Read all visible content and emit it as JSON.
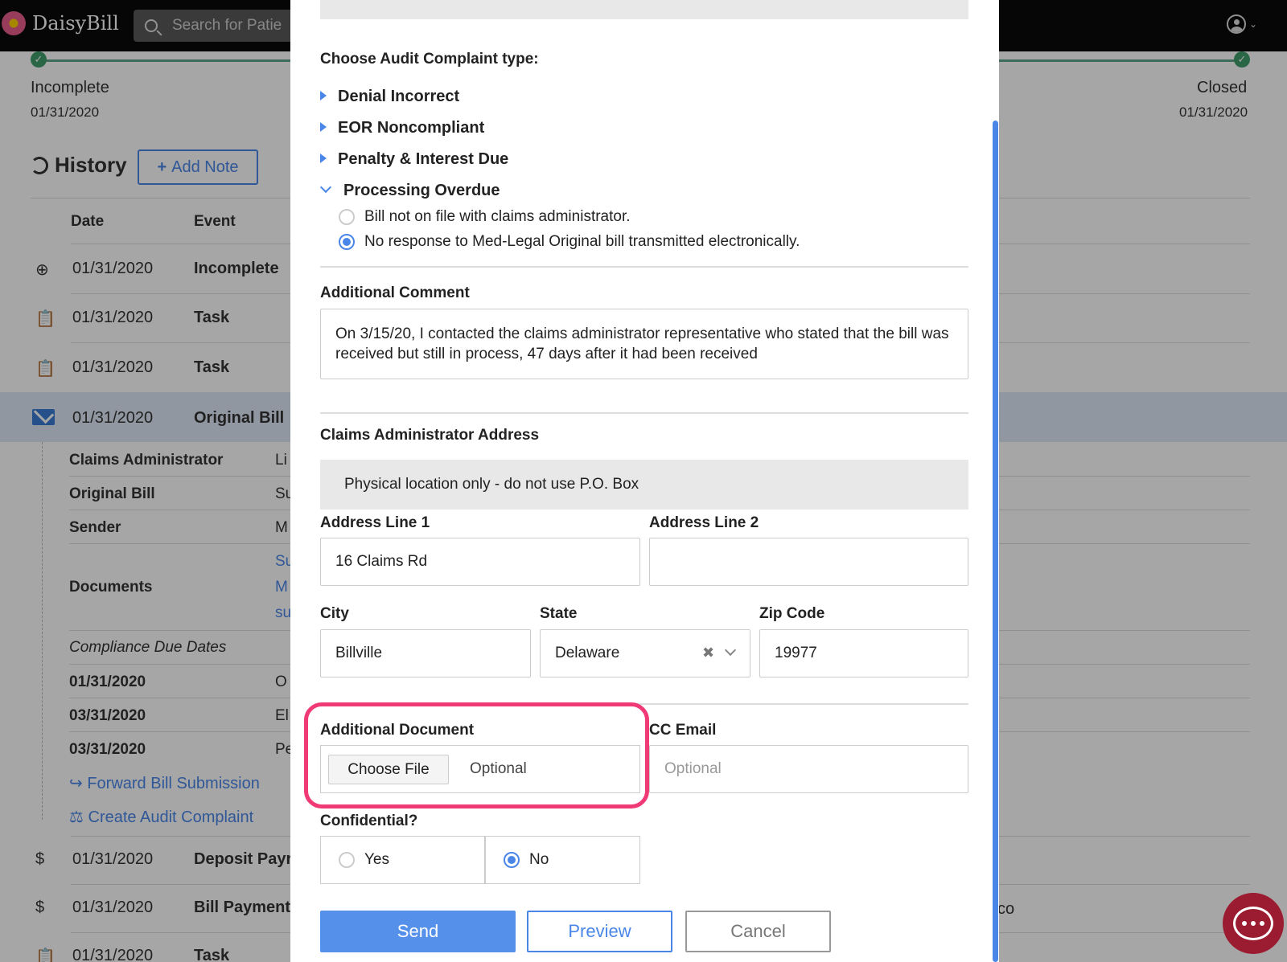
{
  "app": {
    "logo_text": "DaisyBill",
    "search_placeholder": "Search for Patie"
  },
  "progress": {
    "start": {
      "label": "Incomplete",
      "date": "01/31/2020"
    },
    "end": {
      "label": "Closed",
      "date": "01/31/2020"
    }
  },
  "history": {
    "title": "History",
    "add_note_label": "Add Note",
    "columns": {
      "date": "Date",
      "event": "Event"
    },
    "rows": [
      {
        "date": "01/31/2020",
        "event": "Incomplete",
        "icon": "plus-circle-icon"
      },
      {
        "date": "01/31/2020",
        "event": "Task",
        "icon": "clipboard-check-icon"
      },
      {
        "date": "01/31/2020",
        "event": "Task",
        "icon": "clipboard-check-icon"
      },
      {
        "date": "01/31/2020",
        "event": "Original Bill",
        "icon": "envelope-icon"
      },
      {
        "date": "01/31/2020",
        "event": "Deposit Payr",
        "icon": "dollar-hand-icon"
      },
      {
        "date": "01/31/2020",
        "event": "Bill Payment",
        "icon": "dollar-icon"
      },
      {
        "date": "01/31/2020",
        "event": "Task",
        "icon": "clipboard-check-icon"
      }
    ],
    "details": {
      "claims_administrator": {
        "label": "Claims Administrator",
        "value": "Li"
      },
      "original_bill": {
        "label": "Original Bill",
        "value": "Su"
      },
      "sender": {
        "label": "Sender",
        "value": "M"
      },
      "documents": {
        "label": "Documents",
        "values": [
          "Su",
          "M",
          "su"
        ]
      },
      "compliance_title": "Compliance Due Dates",
      "compliance_rows": [
        {
          "date": "01/31/2020",
          "value": "O"
        },
        {
          "date": "03/31/2020",
          "value": "El"
        },
        {
          "date": "03/31/2020",
          "value": "Pe"
        }
      ],
      "forward_link": "Forward Bill Submission",
      "audit_link": "Create Audit Complaint"
    },
    "right_fragment": "co"
  },
  "modal": {
    "complaint_type_label": "Choose Audit Complaint type:",
    "complaint_types": [
      "Denial Incorrect",
      "EOR Noncompliant",
      "Penalty & Interest Due",
      "Processing Overdue"
    ],
    "processing_options": [
      {
        "label": "Bill not on file with claims administrator.",
        "checked": false
      },
      {
        "label": "No response to Med-Legal Original bill transmitted electronically.",
        "checked": true
      }
    ],
    "additional_comment_label": "Additional Comment",
    "additional_comment_value": "On 3/15/20, I contacted the claims administrator representative who stated that the bill was received but still in process, 47 days after it had been received",
    "address_section_label": "Claims Administrator Address",
    "address_note": "Physical location only - do not use P.O. Box",
    "address_line1_label": "Address Line 1",
    "address_line1_value": "16 Claims Rd",
    "address_line2_label": "Address Line 2",
    "address_line2_value": "",
    "city_label": "City",
    "city_value": "Billville",
    "state_label": "State",
    "state_value": "Delaware",
    "zip_label": "Zip Code",
    "zip_value": "19977",
    "additional_document_label": "Additional Document",
    "choose_file_label": "Choose File",
    "file_placeholder": "Optional",
    "cc_email_label": "CC Email",
    "cc_email_placeholder": "Optional",
    "confidential_label": "Confidential?",
    "confidential_options": [
      {
        "label": "Yes",
        "checked": false
      },
      {
        "label": "No",
        "checked": true
      }
    ],
    "send_label": "Send",
    "preview_label": "Preview",
    "cancel_label": "Cancel"
  },
  "colors": {
    "accent": "#4a86e8",
    "highlight_ring": "#f03a76",
    "success": "#3f9d6b"
  }
}
